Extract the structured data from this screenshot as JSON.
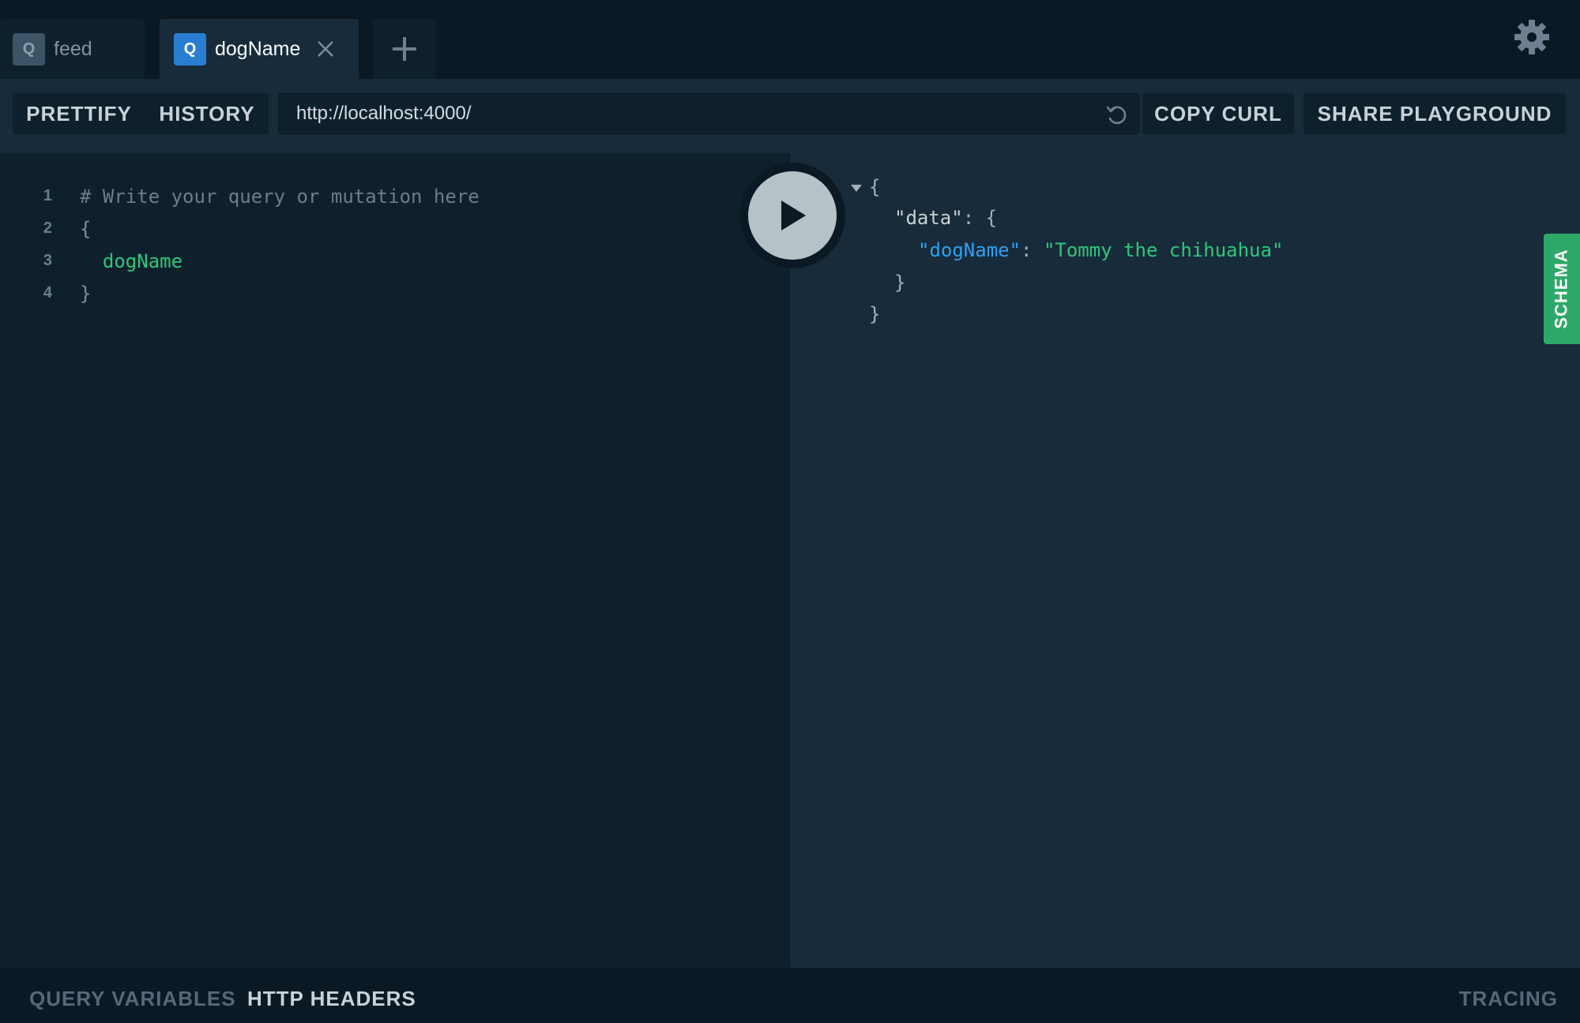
{
  "tabs": [
    {
      "badge": "Q",
      "label": "feed",
      "active": false
    },
    {
      "badge": "Q",
      "label": "dogName",
      "active": true
    }
  ],
  "toolbar": {
    "prettify_label": "PRETTIFY",
    "history_label": "HISTORY",
    "endpoint_url": "http://localhost:4000/",
    "copy_curl_label": "COPY CURL",
    "share_label": "SHARE PLAYGROUND"
  },
  "editor": {
    "lines": [
      {
        "num": "1",
        "text": "# Write your query or mutation here"
      },
      {
        "num": "2",
        "text": "{"
      },
      {
        "num": "3",
        "text": "  dogName"
      },
      {
        "num": "4",
        "text": "}"
      }
    ]
  },
  "result": {
    "open_brace": "{",
    "data_key": "\"data\"",
    "colon_brace": ": {",
    "field_key": "\"dogName\"",
    "colon": ": ",
    "field_value": "\"Tommy the chihuahua\"",
    "close_inner": "}",
    "close_outer": "}"
  },
  "schema_tab_label": "SCHEMA",
  "bottom": {
    "query_variables": "QUERY VARIABLES",
    "http_headers": "HTTP HEADERS",
    "tracing": "TRACING"
  },
  "icons": {
    "close": "close-icon",
    "plus": "plus-icon",
    "gear": "gear-icon",
    "reload": "reload-icon",
    "play": "play-icon"
  },
  "colors": {
    "accent_blue": "#2a7ed2",
    "schema_green": "#2ea868",
    "string_green": "#2ec77b",
    "key_blue": "#2ea0f0"
  }
}
